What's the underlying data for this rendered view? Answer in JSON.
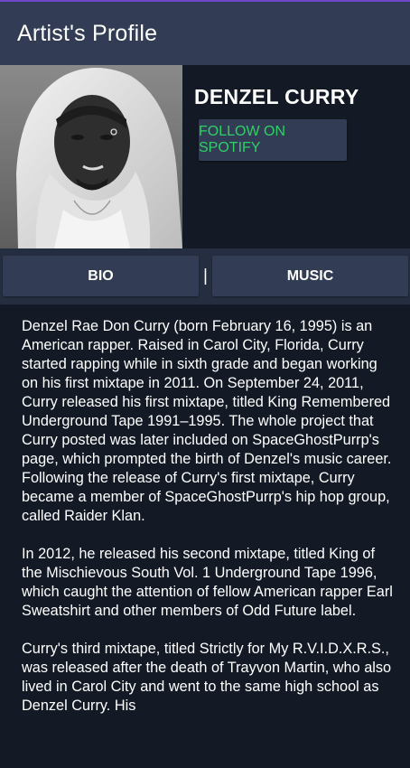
{
  "app_bar": {
    "title": "Artist's Profile"
  },
  "artist": {
    "name": "DENZEL CURRY",
    "follow_label": "FOLLOW ON SPOTIFY"
  },
  "tabs": [
    {
      "label": "BIO"
    },
    {
      "label": "MUSIC"
    }
  ],
  "tab_separator": "|",
  "bio": {
    "paragraphs": [
      "Denzel Rae Don Curry (born February 16, 1995) is an American rapper. Raised in Carol City, Florida, Curry started rapping while in sixth grade and began working on his first mixtape in 2011. On September 24, 2011, Curry released his first mixtape, titled King Remembered Underground Tape 1991–1995. The whole project that Curry posted was later included on SpaceGhostPurrp's page, which prompted the birth of Denzel's music career. Following the release of Curry's first mixtape, Curry became a member of SpaceGhostPurrp's hip hop group, called Raider Klan.",
      "In 2012, he released his second mixtape, titled King of the Mischievous South Vol. 1 Underground Tape 1996, which caught the attention of fellow American rapper Earl Sweatshirt and other members of Odd Future label.",
      "Curry's third mixtape, titled Strictly for My R.V.I.D.X.R.S., was released after the death of Trayvon Martin, who also lived in Carol City and went to the same high school as Denzel Curry. His"
    ]
  },
  "colors": {
    "app_bar": "#323c55",
    "background": "#131a25",
    "spotify_green": "#2fd065"
  }
}
